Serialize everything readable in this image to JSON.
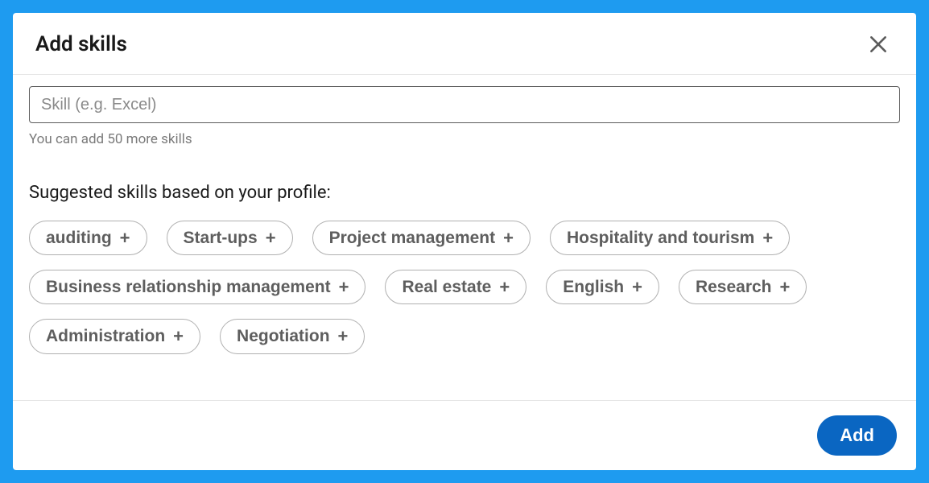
{
  "modal": {
    "title": "Add skills",
    "close_icon": "close"
  },
  "input": {
    "placeholder": "Skill (e.g. Excel)",
    "value": "",
    "helper": "You can add 50 more skills"
  },
  "suggested": {
    "heading": "Suggested skills based on your profile:",
    "skills": [
      "auditing",
      "Start-ups",
      "Project management",
      "Hospitality and tourism",
      "Business relationship management",
      "Real estate",
      "English",
      "Research",
      "Administration",
      "Negotiation"
    ]
  },
  "footer": {
    "add_label": "Add"
  }
}
